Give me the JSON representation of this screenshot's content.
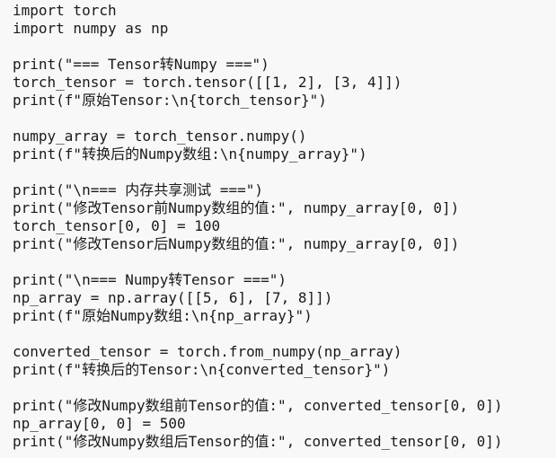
{
  "code_lines": [
    "import torch",
    "import numpy as np",
    "",
    "print(\"=== Tensor转Numpy ===\")",
    "torch_tensor = torch.tensor([[1, 2], [3, 4]])",
    "print(f\"原始Tensor:\\n{torch_tensor}\")",
    "",
    "numpy_array = torch_tensor.numpy()",
    "print(f\"转换后的Numpy数组:\\n{numpy_array}\")",
    "",
    "print(\"\\n=== 内存共享测试 ===\")",
    "print(\"修改Tensor前Numpy数组的值:\", numpy_array[0, 0])",
    "torch_tensor[0, 0] = 100",
    "print(\"修改Tensor后Numpy数组的值:\", numpy_array[0, 0])",
    "",
    "print(\"\\n=== Numpy转Tensor ===\")",
    "np_array = np.array([[5, 6], [7, 8]])",
    "print(f\"原始Numpy数组:\\n{np_array}\")",
    "",
    "converted_tensor = torch.from_numpy(np_array)",
    "print(f\"转换后的Tensor:\\n{converted_tensor}\")",
    "",
    "print(\"修改Numpy数组前Tensor的值:\", converted_tensor[0, 0])",
    "np_array[0, 0] = 500",
    "print(\"修改Numpy数组后Tensor的值:\", converted_tensor[0, 0])"
  ]
}
